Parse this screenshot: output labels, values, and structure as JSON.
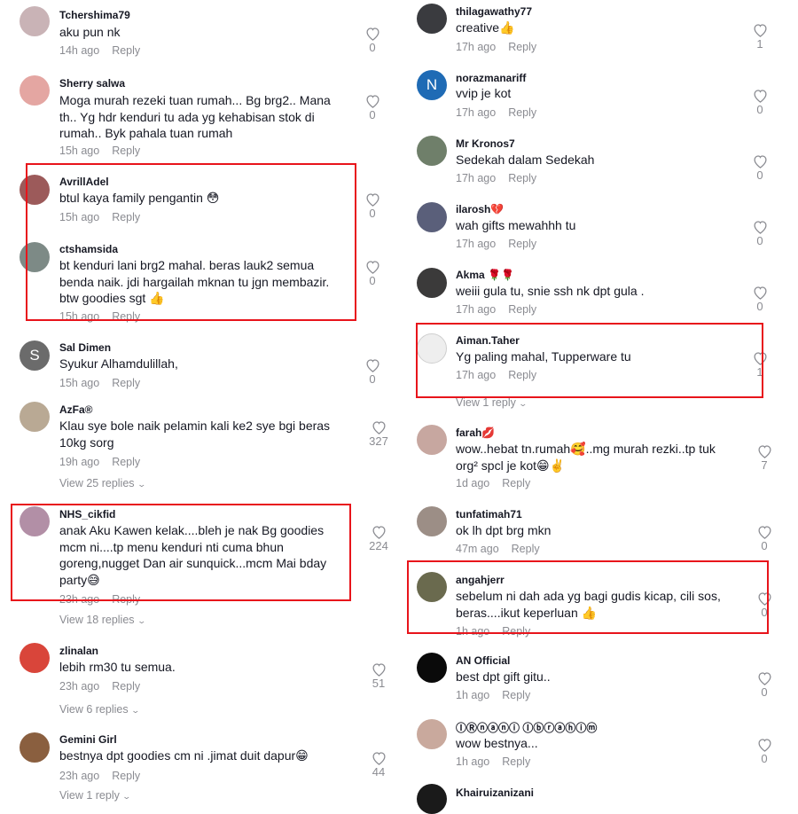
{
  "left": [
    {
      "user": "Tchershima79",
      "text": "aku pun nk",
      "time": "14h ago",
      "likes": "0"
    },
    {
      "user": "Sherry salwa",
      "text": "Moga murah rezeki tuan rumah... Bg brg2.. Mana th.. Yg hdr kenduri tu ada yg kehabisan stok di rumah.. Byk pahala tuan rumah",
      "time": "15h ago",
      "likes": "0"
    },
    {
      "user": "AvrillAdel",
      "text": "btul kaya family pengantin 😳",
      "time": "15h ago",
      "likes": "0"
    },
    {
      "user": "ctshamsida",
      "text": "bt kenduri lani brg2 mahal. beras lauk2 semua benda naik. jdi hargailah mknan tu jgn membazir. btw goodies sgt 👍",
      "time": "15h ago",
      "likes": "0"
    },
    {
      "user": "Sal Dimen",
      "avatar_letter": "S",
      "text": "Syukur Alhamdulillah,",
      "time": "15h ago",
      "likes": "0"
    },
    {
      "user": "AzFa®",
      "text": "Klau sye bole naik pelamin kali ke2 sye bgi beras 10kg sorg",
      "time": "19h ago",
      "likes": "327",
      "view": "View 25 replies"
    },
    {
      "user": "NHS_cikfid",
      "text": "anak Aku Kawen kelak....bleh je nak Bg goodies mcm ni....tp menu kenduri nti cuma bhun goreng,nugget Dan air sunquick...mcm Mai bday party😅",
      "time": "23h ago",
      "likes": "224",
      "view": "View 18 replies"
    },
    {
      "user": "zlinalan",
      "text": "lebih rm30 tu semua.",
      "time": "23h ago",
      "likes": "51",
      "view": "View 6 replies"
    },
    {
      "user": "Gemini Girl",
      "text": "bestnya dpt goodies cm ni .jimat duit dapur😁",
      "time": "23h ago",
      "likes": "44",
      "view": "View 1 reply"
    }
  ],
  "right": [
    {
      "user": "thilagawathy77",
      "text": "creative👍",
      "time": "17h ago",
      "likes": "1"
    },
    {
      "user": "norazmanariff",
      "avatar_letter": "N",
      "text": "vvip je kot",
      "time": "17h ago",
      "likes": "0"
    },
    {
      "user": "Mr Kronos7",
      "text": "Sedekah dalam Sedekah",
      "time": "17h ago",
      "likes": "0"
    },
    {
      "user": "ilarosh💔",
      "text": "wah gifts mewahhh tu",
      "time": "17h ago",
      "likes": "0"
    },
    {
      "user": "Akma 🌹🌹",
      "text": "weiii gula tu, snie ssh nk dpt gula .",
      "time": "17h ago",
      "likes": "0"
    },
    {
      "user": "Aiman.Taher",
      "text": "Yg paling mahal, Tupperware tu",
      "time": "17h ago",
      "likes": "1",
      "view": "View 1 reply"
    },
    {
      "user": "farah💋",
      "text": "wow..hebat tn.rumah🥰..mg murah rezki..tp tuk org² spcl je kot😁✌️",
      "time": "1d ago",
      "likes": "7"
    },
    {
      "user": "tunfatimah71",
      "text": "ok lh dpt brg mkn",
      "time": "47m ago",
      "likes": "0"
    },
    {
      "user": "angahjerr",
      "text": "sebelum ni dah ada yg bagi gudis kicap, cili sos, beras....ikut keperluan 👍",
      "time": "1h ago",
      "likes": "0"
    },
    {
      "user": "AN Official",
      "text": "best dpt gift gitu..",
      "time": "1h ago",
      "likes": "0"
    },
    {
      "user": "ⒾⓇⓝⓐⓝⓘ Ⓘⓑⓡⓐⓗⓘⓜ",
      "text": "wow bestnya...",
      "time": "1h ago",
      "likes": "0"
    },
    {
      "user": "Khairuizanizani",
      "text": "",
      "time": "",
      "likes": ""
    }
  ],
  "reply_label": "Reply",
  "colors": {
    "highlight": "#e8141b",
    "meta": "#8a8b91",
    "text": "#161823",
    "avatar_letter_bg": "#6b6b6b",
    "avatar_n_bg": "#1f6bb5"
  }
}
